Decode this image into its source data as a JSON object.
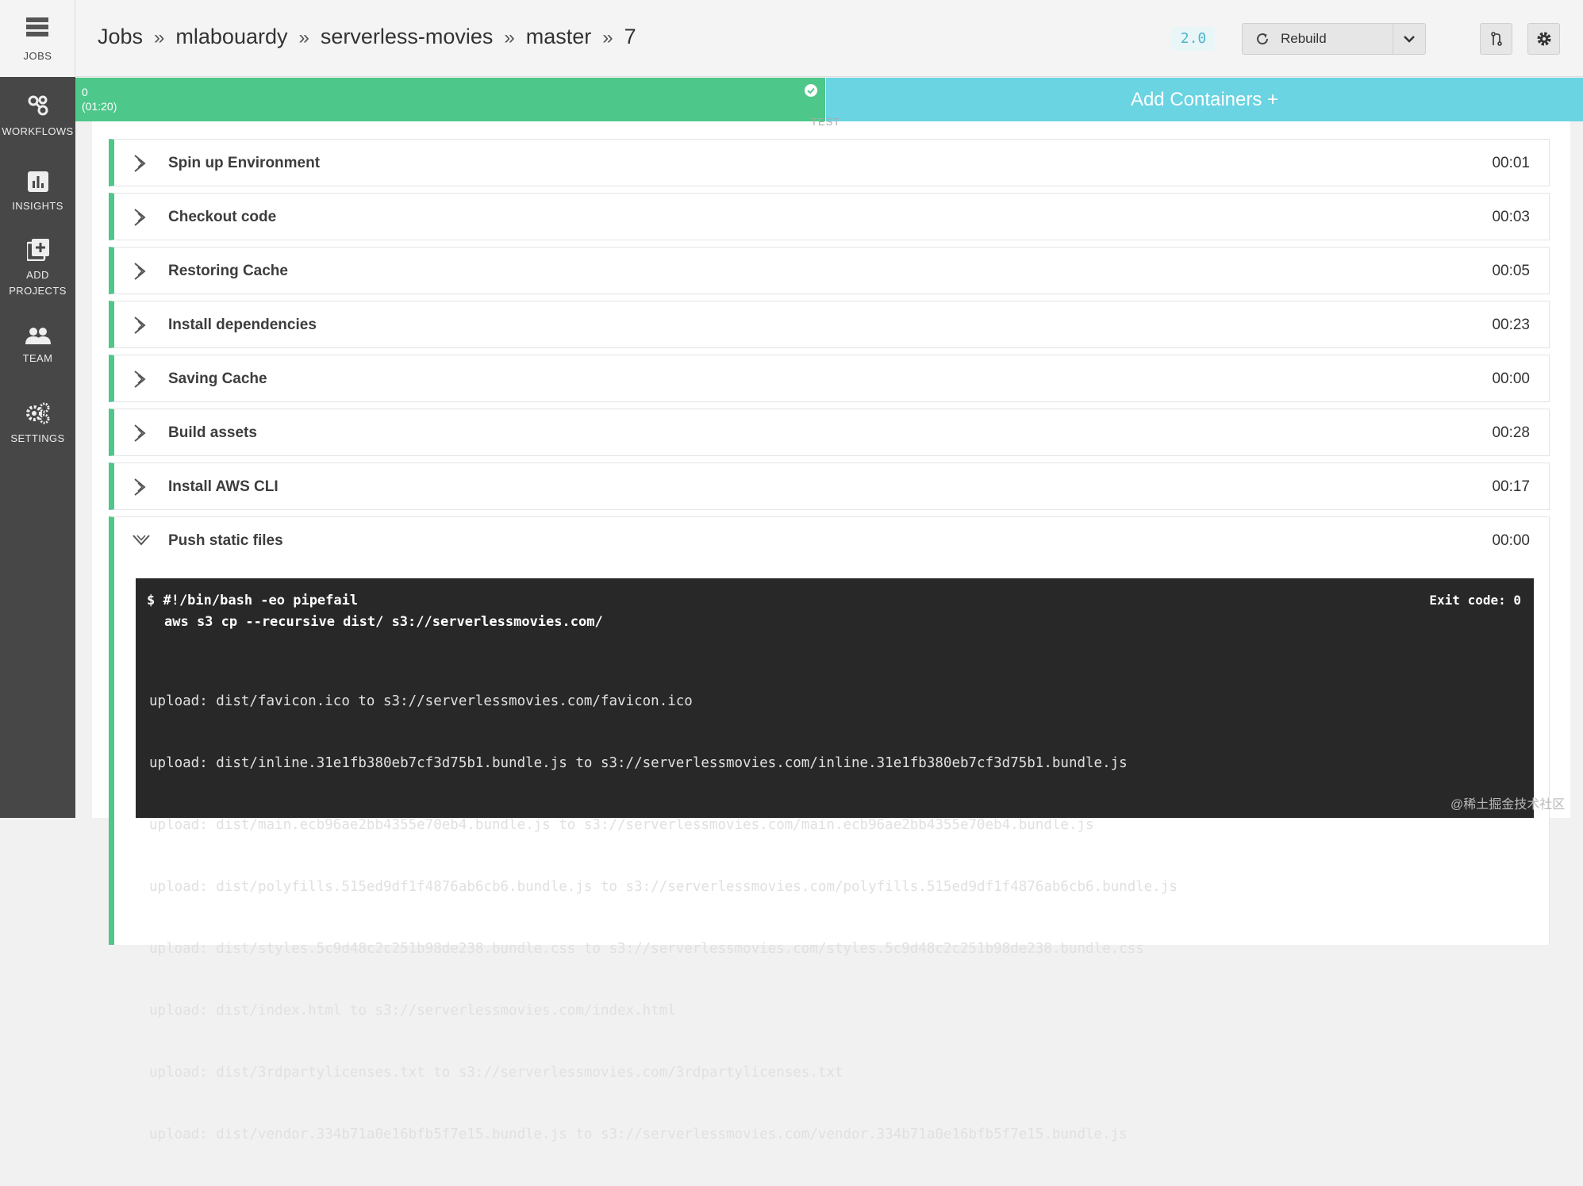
{
  "sidebar": {
    "top": {
      "label": "JOBS",
      "icon": "jobs-icon"
    },
    "items": [
      {
        "label": "WORKFLOWS",
        "icon": "workflows-icon"
      },
      {
        "label": "INSIGHTS",
        "icon": "insights-icon"
      },
      {
        "label": "ADD",
        "label2": "PROJECTS",
        "icon": "add-projects-icon"
      },
      {
        "label": "TEAM",
        "icon": "team-icon"
      },
      {
        "label": "SETTINGS",
        "icon": "settings-icon"
      }
    ]
  },
  "header": {
    "breadcrumb": [
      "Jobs",
      "mlabouardy",
      "serverless-movies",
      "master",
      "7"
    ],
    "separator": "»",
    "version": "2.0",
    "rebuild_label": "Rebuild"
  },
  "containers": {
    "index": "0",
    "duration": "(01:20)",
    "add_label": "Add Containers +",
    "faint_label": "TEST",
    "success_color": "#4dc78a",
    "add_color": "#6ad4e2"
  },
  "steps": [
    {
      "name": "Spin up Environment",
      "duration": "00:01"
    },
    {
      "name": "Checkout code",
      "duration": "00:03"
    },
    {
      "name": "Restoring Cache",
      "duration": "00:05"
    },
    {
      "name": "Install dependencies",
      "duration": "00:23"
    },
    {
      "name": "Saving Cache",
      "duration": "00:00"
    },
    {
      "name": "Build assets",
      "duration": "00:28"
    },
    {
      "name": "Install AWS CLI",
      "duration": "00:17"
    },
    {
      "name": "Push static files",
      "duration": "00:00"
    }
  ],
  "terminal": {
    "command_line1": "$ #!/bin/bash -eo pipefail",
    "command_line2": "aws s3 cp --recursive dist/ s3://serverlessmovies.com/",
    "exit_code": "Exit code: 0",
    "output": [
      "upload: dist/favicon.ico to s3://serverlessmovies.com/favicon.ico",
      "upload: dist/inline.31e1fb380eb7cf3d75b1.bundle.js to s3://serverlessmovies.com/inline.31e1fb380eb7cf3d75b1.bundle.js",
      "upload: dist/main.ecb96ae2bb4355e70eb4.bundle.js to s3://serverlessmovies.com/main.ecb96ae2bb4355e70eb4.bundle.js",
      "upload: dist/polyfills.515ed9df1f4876ab6cb6.bundle.js to s3://serverlessmovies.com/polyfills.515ed9df1f4876ab6cb6.bundle.js",
      "upload: dist/styles.5c9d48c2c251b98de238.bundle.css to s3://serverlessmovies.com/styles.5c9d48c2c251b98de238.bundle.css",
      "upload: dist/index.html to s3://serverlessmovies.com/index.html",
      "upload: dist/3rdpartylicenses.txt to s3://serverlessmovies.com/3rdpartylicenses.txt",
      "upload: dist/vendor.334b71a0e16bfb5f7e15.bundle.js to s3://serverlessmovies.com/vendor.334b71a0e16bfb5f7e15.bundle.js"
    ]
  },
  "watermark": "@稀土掘金技术社区"
}
